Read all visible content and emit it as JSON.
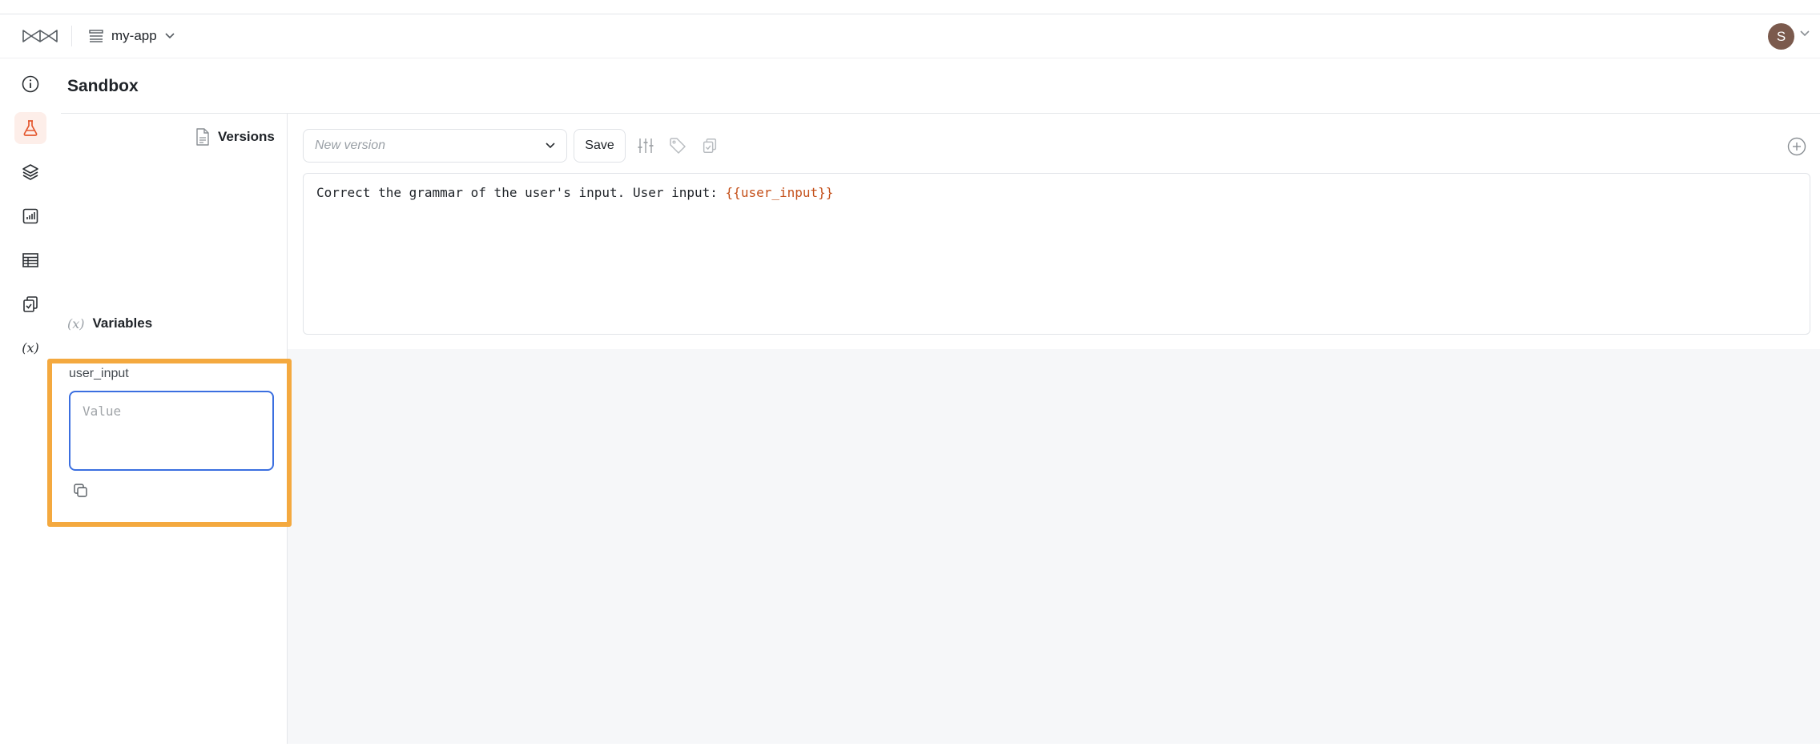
{
  "header": {
    "app_name": "my-app",
    "avatar_initial": "S"
  },
  "rail": {
    "items": [
      {
        "name": "info-icon",
        "active": false
      },
      {
        "name": "flask-icon",
        "active": true
      },
      {
        "name": "layers-icon",
        "active": false
      },
      {
        "name": "chart-icon",
        "active": false
      },
      {
        "name": "table-icon",
        "active": false
      },
      {
        "name": "clipboard-check-icon",
        "active": false
      },
      {
        "name": "variable-icon",
        "active": false
      }
    ]
  },
  "page": {
    "title": "Sandbox"
  },
  "side": {
    "versions_label": "Versions",
    "variables_glyph": "(x)",
    "variables_label": "Variables",
    "variable": {
      "name": "user_input",
      "placeholder": "Value",
      "value": ""
    }
  },
  "editor": {
    "version_placeholder": "New version",
    "save_label": "Save",
    "prompt_text": "Correct the grammar of the user's input. User input: ",
    "prompt_variable": "{{user_input}}"
  },
  "colors": {
    "accent": "#e4572e",
    "highlight_border": "#f4a93f",
    "focus_border": "#3b6fe0",
    "variable_text": "#c4501a"
  }
}
